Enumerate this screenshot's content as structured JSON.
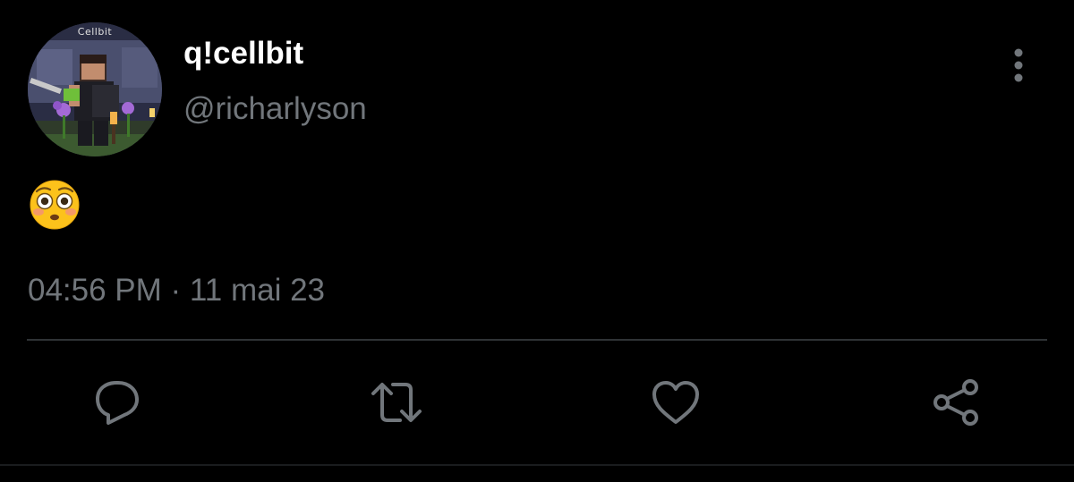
{
  "tweet": {
    "avatar": {
      "badge_text": "Cellbit"
    },
    "author": {
      "display_name": "q!cellbit",
      "handle": "@richarlyson"
    },
    "text": "😳",
    "timestamp": "04:56 PM · 11 mai 23"
  },
  "actions": {
    "reply_icon": "reply-icon",
    "retweet_icon": "retweet-icon",
    "like_icon": "heart-icon",
    "share_icon": "share-icon"
  },
  "colors": {
    "background": "#000000",
    "primary_text": "#ffffff",
    "secondary_text": "#71767b",
    "divider": "#2f3336",
    "icon": "#71767b"
  }
}
